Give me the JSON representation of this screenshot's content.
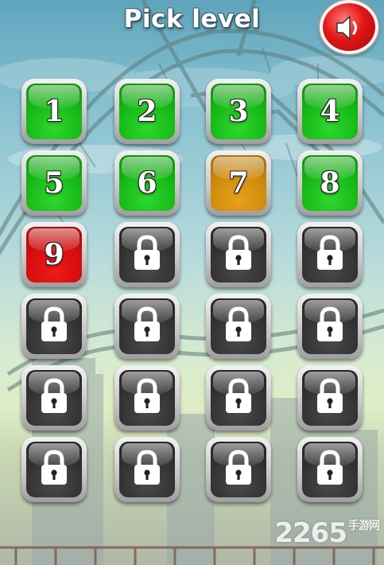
{
  "header": {
    "title": "Pick level"
  },
  "sound_button": {
    "icon": "speaker-icon",
    "color": "#e21616"
  },
  "levels": [
    {
      "label": "1",
      "state": "completed"
    },
    {
      "label": "2",
      "state": "completed"
    },
    {
      "label": "3",
      "state": "completed"
    },
    {
      "label": "4",
      "state": "completed"
    },
    {
      "label": "5",
      "state": "completed"
    },
    {
      "label": "6",
      "state": "completed"
    },
    {
      "label": "7",
      "state": "partial"
    },
    {
      "label": "8",
      "state": "completed"
    },
    {
      "label": "9",
      "state": "current"
    },
    {
      "label": "",
      "state": "locked"
    },
    {
      "label": "",
      "state": "locked"
    },
    {
      "label": "",
      "state": "locked"
    },
    {
      "label": "",
      "state": "locked"
    },
    {
      "label": "",
      "state": "locked"
    },
    {
      "label": "",
      "state": "locked"
    },
    {
      "label": "",
      "state": "locked"
    },
    {
      "label": "",
      "state": "locked"
    },
    {
      "label": "",
      "state": "locked"
    },
    {
      "label": "",
      "state": "locked"
    },
    {
      "label": "",
      "state": "locked"
    },
    {
      "label": "",
      "state": "locked"
    },
    {
      "label": "",
      "state": "locked"
    },
    {
      "label": "",
      "state": "locked"
    },
    {
      "label": "",
      "state": "locked"
    }
  ],
  "colors": {
    "completed": "#16b816",
    "partial": "#cf8a0c",
    "current": "#d40d0d",
    "locked": "#333333"
  },
  "watermark": {
    "number": "2265",
    "suffix": "手游网"
  }
}
